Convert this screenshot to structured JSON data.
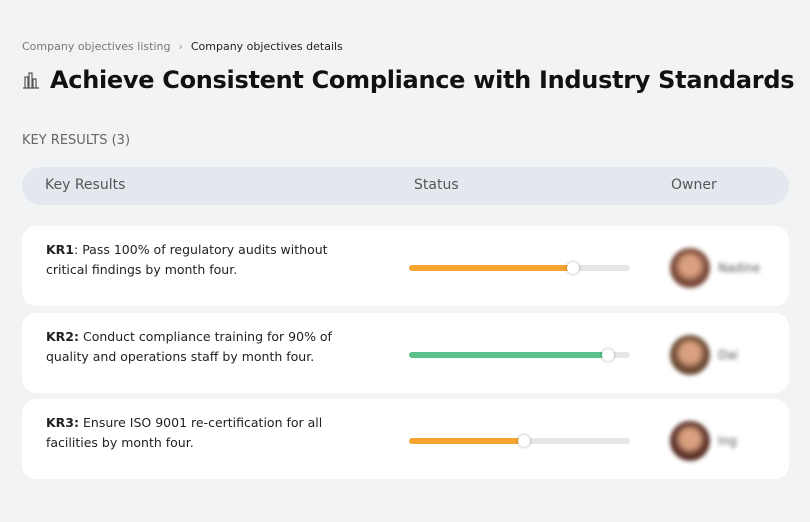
{
  "breadcrumb": {
    "parent": "Company objectives listing",
    "separator": "›",
    "current": "Company objectives details"
  },
  "title": "Achieve Consistent Compliance with Industry Standards",
  "key_results_label": "KEY RESULTS (3)",
  "table": {
    "headers": {
      "key_results": "Key Results",
      "status": "Status",
      "owner": "Owner"
    }
  },
  "rows": [
    {
      "id": "KR1",
      "sep": ": ",
      "text": "Pass 100% of regulatory audits without critical findings by month four.",
      "progress": 74,
      "color": "#f7a531",
      "owner": "Nadine",
      "avatar": "#7a4a3a"
    },
    {
      "id": "KR2:",
      "sep": " ",
      "text": "Conduct compliance training for 90% of quality and operations staff by month four.",
      "progress": 90,
      "color": "#5cc28b",
      "owner": "Dai",
      "avatar": "#6b4a33"
    },
    {
      "id": "KR3:",
      "sep": " ",
      "text": "Ensure ISO 9001 re-certification for all facilities by month four.",
      "progress": 52,
      "color": "#f7a531",
      "owner": "Ing",
      "avatar": "#5a3028"
    }
  ]
}
